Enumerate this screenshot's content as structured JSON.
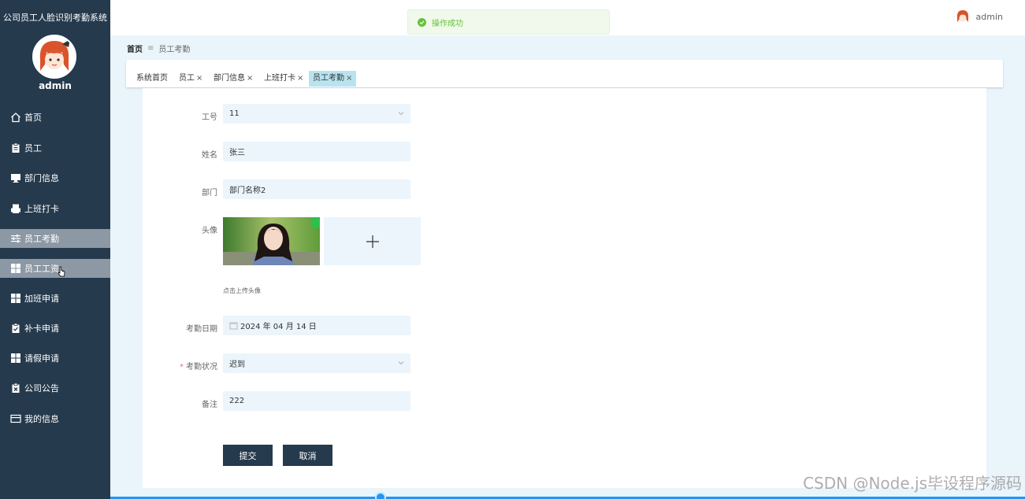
{
  "app": {
    "title": "公司员工人脸识别考勤系统"
  },
  "sidebar": {
    "username": "admin",
    "items": [
      {
        "label": "首页",
        "icon": "home-icon"
      },
      {
        "label": "员工",
        "icon": "clipboard-icon"
      },
      {
        "label": "部门信息",
        "icon": "monitor-icon"
      },
      {
        "label": "上班打卡",
        "icon": "printer-icon"
      },
      {
        "label": "员工考勤",
        "icon": "sliders-icon"
      },
      {
        "label": "员工工资",
        "icon": "grid-icon"
      },
      {
        "label": "加班申请",
        "icon": "grid-icon"
      },
      {
        "label": "补卡申请",
        "icon": "check-clipboard-icon"
      },
      {
        "label": "请假申请",
        "icon": "grid-icon"
      },
      {
        "label": "公司公告",
        "icon": "x-clipboard-icon"
      },
      {
        "label": "我的信息",
        "icon": "card-icon"
      }
    ]
  },
  "header": {
    "toast": "操作成功",
    "username": "admin"
  },
  "breadcrumb": {
    "home": "首页",
    "current": "员工考勤"
  },
  "tags": [
    {
      "label": "系统首页",
      "closable": false
    },
    {
      "label": "员工",
      "closable": true
    },
    {
      "label": "部门信息",
      "closable": true
    },
    {
      "label": "上班打卡",
      "closable": true
    },
    {
      "label": "员工考勤",
      "closable": true,
      "active": true
    }
  ],
  "tag_close_symbol": "×",
  "form": {
    "employee_id": {
      "label": "工号",
      "value": "11"
    },
    "name": {
      "label": "姓名",
      "value": "张三"
    },
    "department": {
      "label": "部门",
      "value": "部门名称2"
    },
    "avatar": {
      "label": "头像",
      "hint": "点击上传头像"
    },
    "date": {
      "label": "考勤日期",
      "value": "2024 年 04 月 14 日"
    },
    "status": {
      "label": "考勤状况",
      "value": "迟到",
      "required": "*"
    },
    "remark": {
      "label": "备注",
      "value": "222"
    },
    "submit_label": "提交",
    "cancel_label": "取消"
  },
  "watermark": "CSDN @Node.js毕设程序源码",
  "colors": {
    "sidebar_bg": "#253a4d",
    "menu_highlight": "#8c98a4",
    "accent_tag": "#b8e4f0",
    "field_bg": "#ebf5fb",
    "success": "#67c23a",
    "button_bg": "#253a4d"
  }
}
